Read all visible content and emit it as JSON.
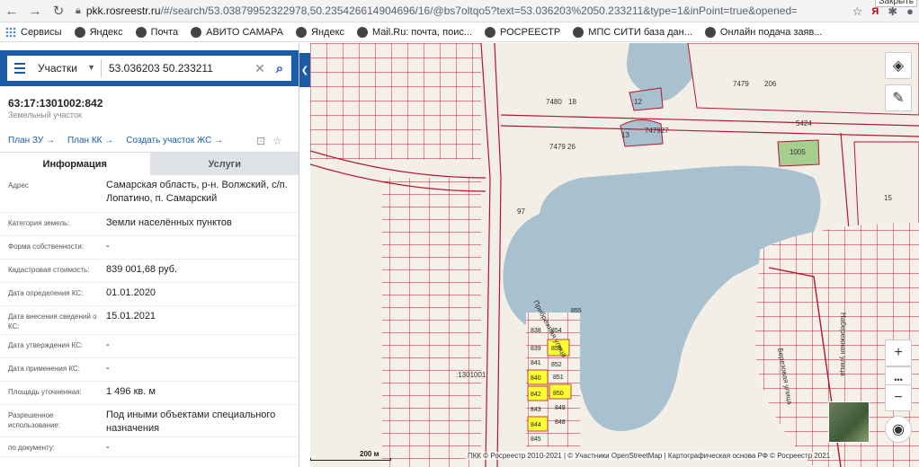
{
  "browser": {
    "url_host": "pkk.rosreestr.ru",
    "url_rest": "/#/search/53.03879952322978,50.235426614904696/16/@bs7oltqo5?text=53.036203%2050.233211&type=1&inPoint=true&opened=63%3A17%...",
    "close_label": "Закрыть"
  },
  "bookmarks": [
    {
      "label": "Сервисы",
      "color": "#4285f4"
    },
    {
      "label": "Яндекс",
      "color": "#444444"
    },
    {
      "label": "Почта",
      "color": "#444444"
    },
    {
      "label": "АВИТО САМАРА",
      "color": "#444444"
    },
    {
      "label": "Яндекс",
      "color": "#444444"
    },
    {
      "label": "Mail.Ru: почта, поис...",
      "color": "#444444"
    },
    {
      "label": "РОСРЕЕСТР",
      "color": "#444444"
    },
    {
      "label": "МПС СИТИ база дан...",
      "color": "#444444"
    },
    {
      "label": "Онлайн подача заяв...",
      "color": "#444444"
    }
  ],
  "search": {
    "type": "Участки",
    "query": "53.036203 50.233211"
  },
  "object": {
    "id": "63:17:1301002:842",
    "type": "Земельный участок"
  },
  "links": {
    "plan_zu": "План ЗУ →",
    "plan_kk": "План КК →",
    "create": "Создать участок ЖС →"
  },
  "tabs": {
    "info": "Информация",
    "services": "Услуги"
  },
  "properties": [
    {
      "key": "Адрес",
      "value": "Самарская область, р-н. Волжский, с/п. Лопатино, п. Самарский"
    },
    {
      "key": "Категория земель:",
      "value": "Земли населённых пунктов"
    },
    {
      "key": "Форма собственности:",
      "value": "-"
    },
    {
      "key": "Кадастровая стоимость:",
      "value": "839 001,68 руб."
    },
    {
      "key": "Дата определения КС:",
      "value": "01.01.2020"
    },
    {
      "key": "Дата внесения сведений о КС:",
      "value": "15.01.2021"
    },
    {
      "key": "Дата утверждения КС:",
      "value": "-"
    },
    {
      "key": "Дата применения КС:",
      "value": "-"
    },
    {
      "key": "Площадь уточненная:",
      "value": "1 496 кв. м"
    },
    {
      "key": "Разрешенное использование:",
      "value": "Под иными объектами специального назначения"
    },
    {
      "key": "по документу:",
      "value": "-"
    }
  ],
  "map": {
    "scale_label": "200 м",
    "attribution": "ПКК © Росреестр 2010-2021 | © Участники OpenStreetMap | Картографическая основа РФ © Росреестр 2021",
    "water_color": "#a9c0cf",
    "parcel_color": "#b3162e",
    "highlight_color": "#ffff33",
    "street_pribrezhnaya": "Прибрежная улица",
    "street_naberezhnaya": "Набережная улица",
    "street_berezovaya": "Березовая улица",
    "quarter_label": ":1301001",
    "parcel_labels": [
      "853",
      "852",
      "851",
      "850",
      "849",
      "848",
      "839",
      "838",
      "840",
      "841",
      "842",
      "843",
      "844",
      "845",
      "854",
      "855",
      "7479",
      "206",
      "7480",
      "18",
      "12",
      "13",
      "1005",
      "15",
      "97",
      "5424",
      "747927",
      "7479 26"
    ],
    "highlighted": [
      "853",
      "842",
      "850",
      "844",
      "840"
    ]
  },
  "map_controls": {
    "layers_icon": "layers-icon",
    "ruler_icon": "ruler-icon",
    "zoom_in": "+",
    "more": "•••",
    "zoom_out": "−",
    "locate_icon": "locate-icon"
  }
}
